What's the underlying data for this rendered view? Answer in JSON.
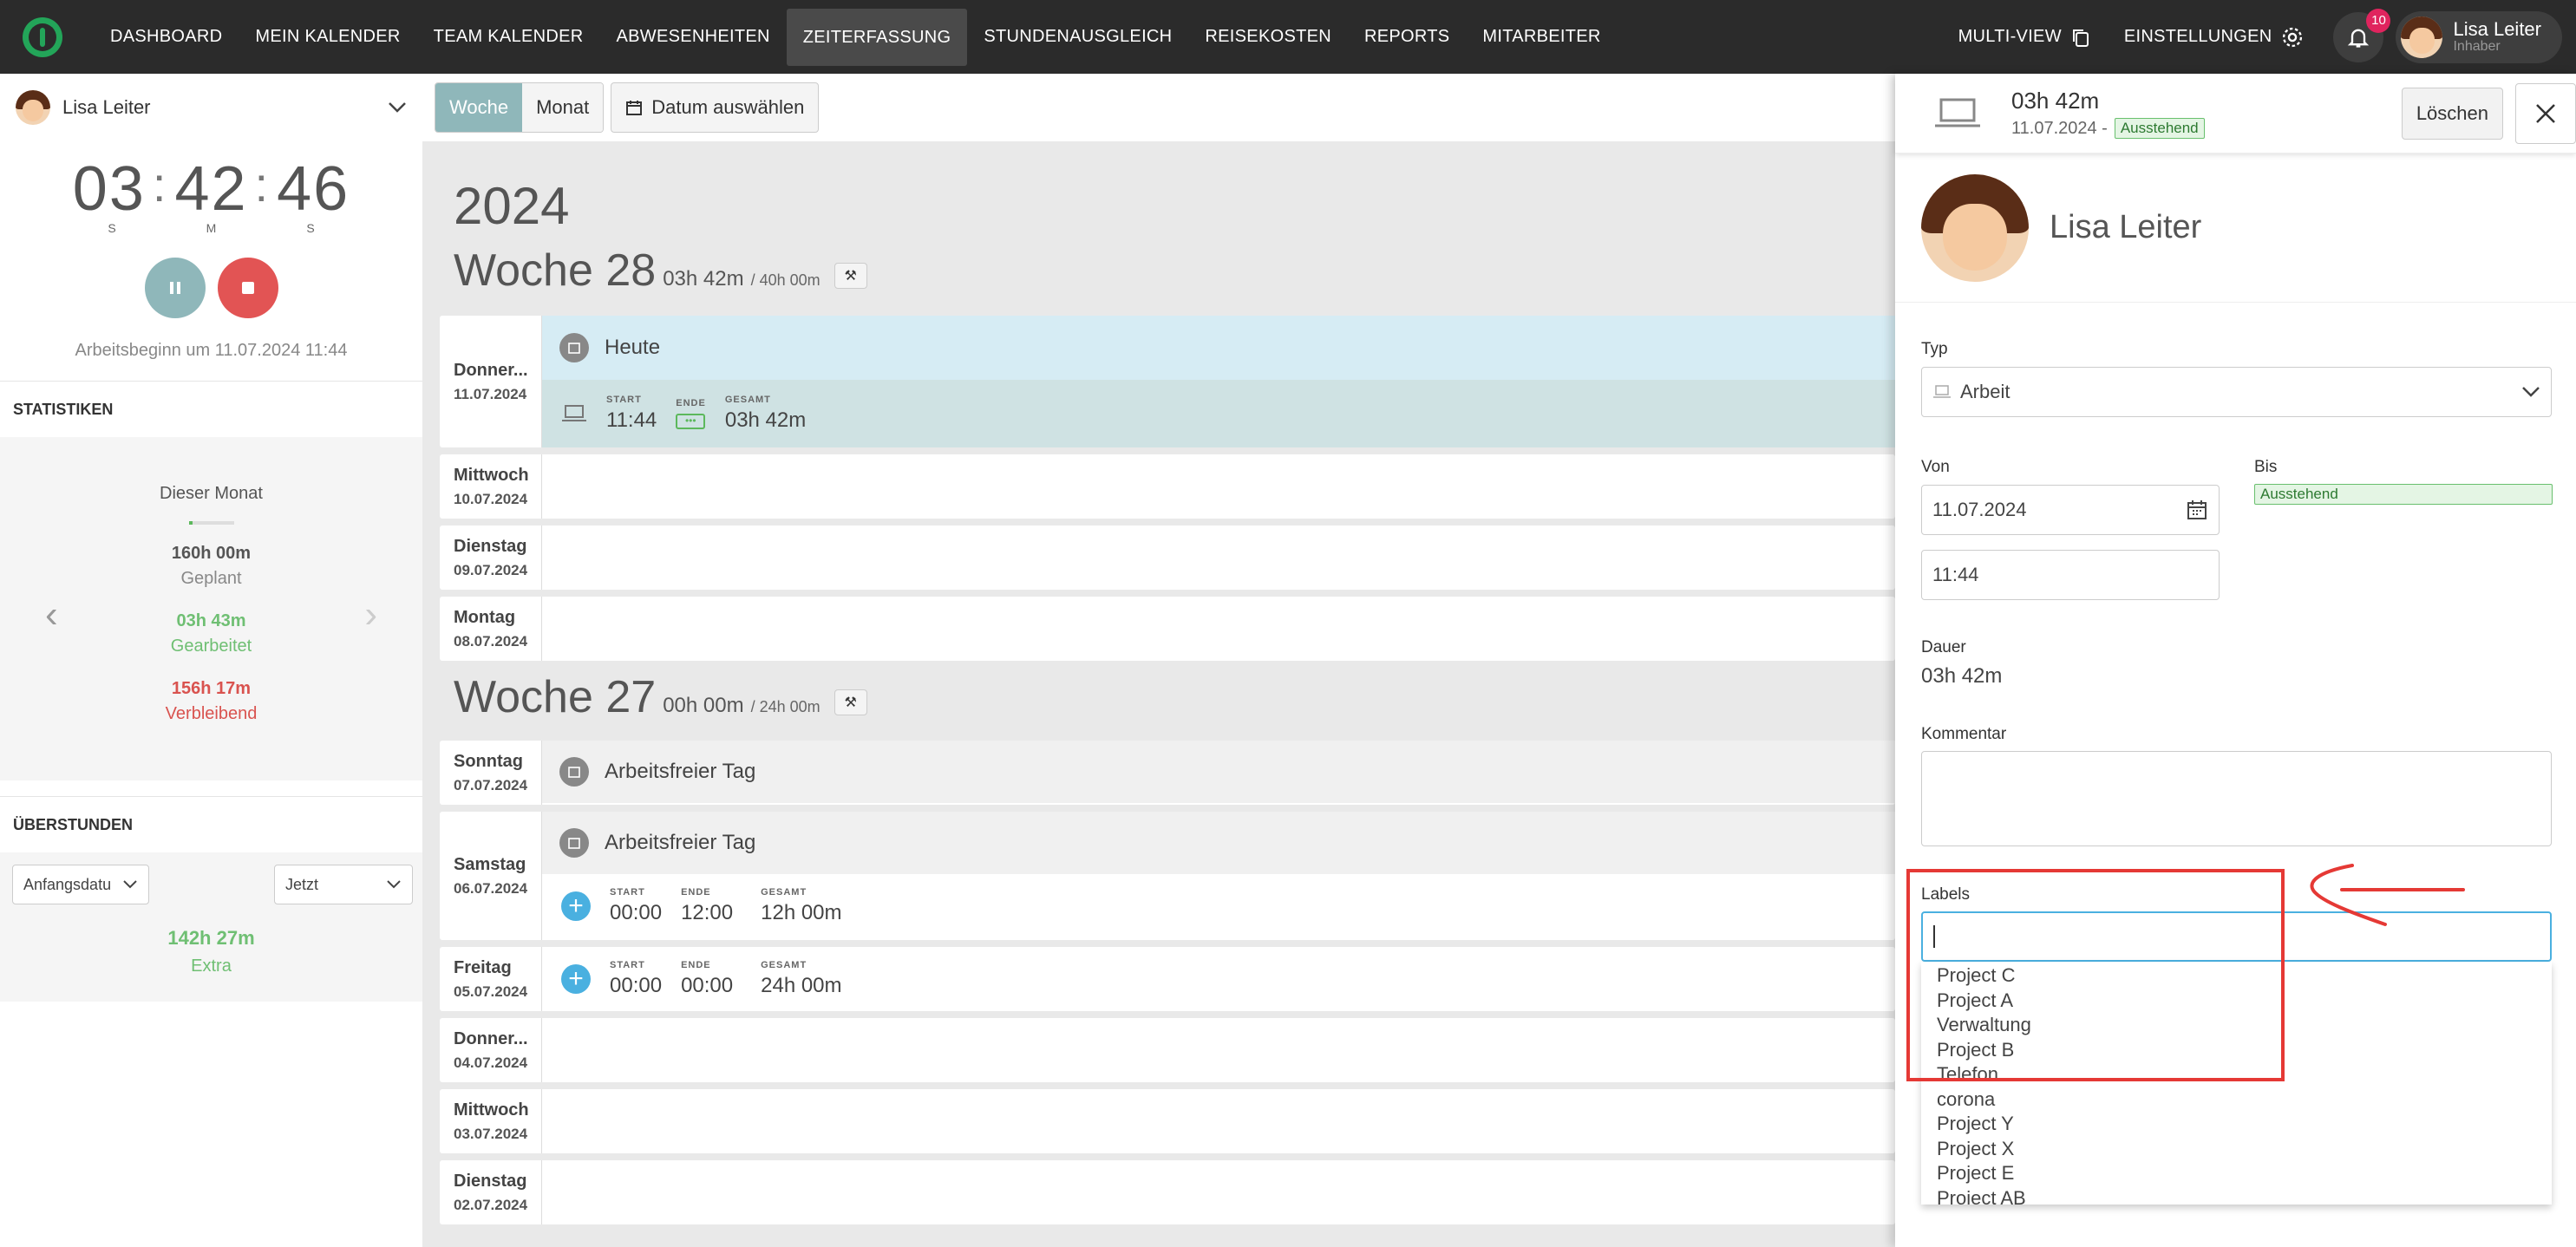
{
  "nav": {
    "items": [
      "Dashboard",
      "Mein Kalender",
      "Team Kalender",
      "Abwesenheiten",
      "Zeiterfassung",
      "Stundenausgleich",
      "Reisekosten",
      "Reports",
      "Mitarbeiter"
    ],
    "active": "Zeiterfassung",
    "multiview": "Multi-View",
    "settings": "Einstellungen",
    "notifications": "10",
    "user_name": "Lisa Leiter",
    "user_role": "Inhaber"
  },
  "sidebar": {
    "user": "Lisa Leiter",
    "timer": {
      "h": "03",
      "m": "42",
      "s": "46",
      "unit_h": "S",
      "unit_m": "M",
      "unit_s": "S"
    },
    "start_info": "Arbeitsbeginn um 11.07.2024 11:44",
    "stats_title": "STATISTIKEN",
    "stats": {
      "period": "Dieser Monat",
      "planned_val": "160h 00m",
      "planned_lbl": "Geplant",
      "worked_val": "03h 43m",
      "worked_lbl": "Gearbeitet",
      "remaining_val": "156h 17m",
      "remaining_lbl": "Verbleibend"
    },
    "overtime_title": "ÜBERSTUNDEN",
    "overtime": {
      "from": "Anfangsdatu",
      "to": "Jetzt",
      "value": "142h 27m",
      "label": "Extra"
    }
  },
  "toolbar": {
    "week": "Woche",
    "month": "Monat",
    "date_picker": "Datum auswählen"
  },
  "main": {
    "year": "2024",
    "weeks": [
      {
        "title": "Woche 28",
        "hours": "03h 42m",
        "target": "/ 40h 00m",
        "days": [
          {
            "name": "Donner...",
            "date": "11.07.2024",
            "event": "Heute",
            "entry": {
              "start": "11:44",
              "end": "•••",
              "total": "03h 42m"
            }
          },
          {
            "name": "Mittwoch",
            "date": "10.07.2024"
          },
          {
            "name": "Dienstag",
            "date": "09.07.2024"
          },
          {
            "name": "Montag",
            "date": "08.07.2024"
          }
        ]
      },
      {
        "title": "Woche 27",
        "hours": "00h 00m",
        "target": "/ 24h 00m",
        "days": [
          {
            "name": "Sonntag",
            "date": "07.07.2024",
            "event": "Arbeitsfreier Tag"
          },
          {
            "name": "Samstag",
            "date": "06.07.2024",
            "event": "Arbeitsfreier Tag",
            "entry": {
              "start": "00:00",
              "end": "12:00",
              "total": "12h 00m"
            }
          },
          {
            "name": "Freitag",
            "date": "05.07.2024",
            "entry": {
              "start": "00:00",
              "end": "00:00",
              "total": "24h 00m"
            }
          },
          {
            "name": "Donner...",
            "date": "04.07.2024"
          },
          {
            "name": "Mittwoch",
            "date": "03.07.2024"
          },
          {
            "name": "Dienstag",
            "date": "02.07.2024"
          }
        ]
      }
    ],
    "field_labels": {
      "start": "START",
      "end": "ENDE",
      "total": "GESAMT"
    }
  },
  "panel": {
    "duration": "03h 42m",
    "date": "11.07.2024 -",
    "status": "Ausstehend",
    "delete": "Löschen",
    "user": "Lisa Leiter",
    "type_label": "Typ",
    "type_value": "Arbeit",
    "from_label": "Von",
    "to_label": "Bis",
    "from_date": "11.07.2024",
    "from_time": "11:44",
    "to_status": "Ausstehend",
    "duration_label": "Dauer",
    "duration_value": "03h 42m",
    "comment_label": "Kommentar",
    "labels_label": "Labels",
    "label_options": [
      "Project C",
      "Project A",
      "Verwaltung",
      "Project B",
      "Telefon",
      "corona",
      "Project Y",
      "Project X",
      "Project E",
      "Project AB"
    ]
  },
  "colors": {
    "accent": "#8fb7ba",
    "stop": "#e25454",
    "green": "#6fbf73",
    "red": "#d9534f",
    "highlight": "#e53935"
  }
}
